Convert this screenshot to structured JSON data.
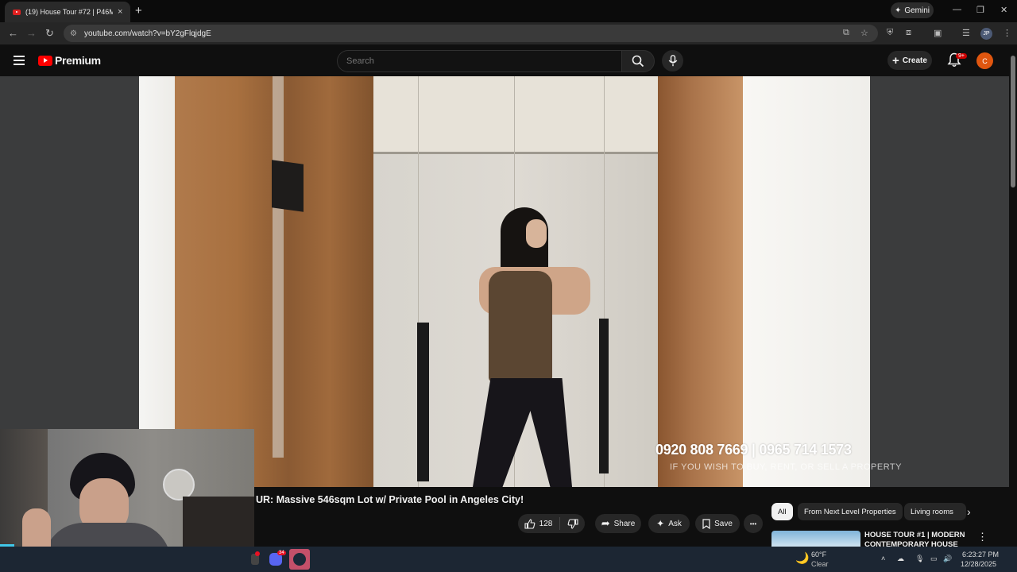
{
  "browser": {
    "tab_title": "(19) House Tour #72 | P46M LU",
    "tab_close": "×",
    "new_tab": "+",
    "url": "youtube.com/watch?v=bY2gFlqjdgE",
    "gemini_label": "Gemini"
  },
  "youtube": {
    "logo_text": "Premium",
    "search_placeholder": "Search",
    "create_label": "Create",
    "notification_badge": "9+",
    "avatar_letter": "C"
  },
  "video": {
    "overlay_phone": "0920 808 7669  |  0965 714 1573",
    "overlay_sub": "IF YOU WISH TO BUY, RENT, OR SELL A PROPERTY",
    "title": "UR: Massive 546sqm Lot w/ Private Pool in Angeles City!"
  },
  "actions": {
    "like_count": "128",
    "share_label": "Share",
    "ask_label": "Ask",
    "save_label": "Save",
    "more_label": "•••"
  },
  "chips": [
    "All",
    "From Next Level Properties",
    "Living rooms"
  ],
  "suggestion": {
    "title": "HOUSE TOUR #1 | MODERN CONTEMPORARY HOUSE FOR"
  },
  "taskbar": {
    "weather_temp": "60°F",
    "weather_desc": "Clear",
    "time": "6:23:27 PM",
    "date": "12/28/2025",
    "profile_initials": "JP",
    "discord_badge": "34"
  }
}
